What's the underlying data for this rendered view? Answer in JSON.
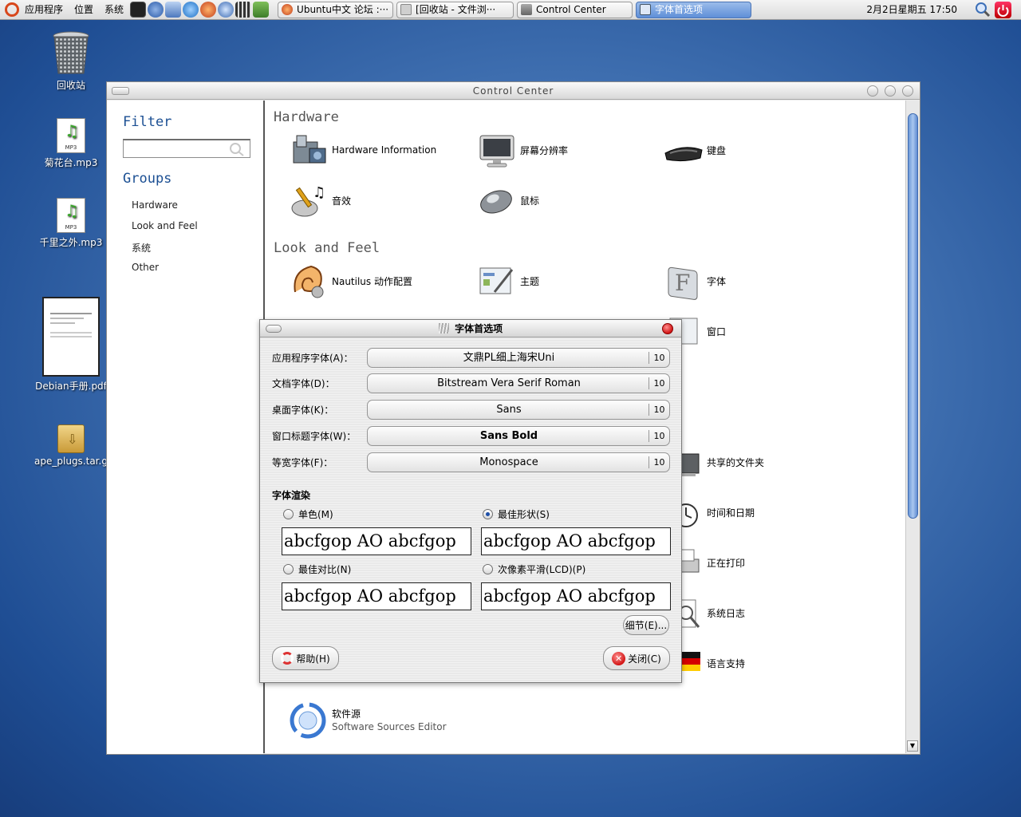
{
  "panel": {
    "menus": [
      "应用程序",
      "位置",
      "系统"
    ],
    "tasks": [
      {
        "label": "Ubuntu中文 论坛 :···"
      },
      {
        "label": "[回收站 - 文件浏···"
      },
      {
        "label": "Control Center"
      },
      {
        "label": "字体首选项"
      }
    ],
    "clock": "2月2日星期五 17:50"
  },
  "desktop": {
    "icons": [
      {
        "label": "回收站"
      },
      {
        "label": "菊花台.mp3",
        "badge": "MP3"
      },
      {
        "label": "千里之外.mp3",
        "badge": "MP3"
      },
      {
        "label": "Debian手册.pdf"
      },
      {
        "label": "ape_plugs.tar.g"
      }
    ]
  },
  "window": {
    "title": "Control Center",
    "filter": {
      "heading": "Filter",
      "value": ""
    },
    "groups": {
      "heading": "Groups",
      "items": [
        "Hardware",
        "Look and Feel",
        "系统",
        "Other"
      ]
    },
    "sections": {
      "hardware": {
        "title": "Hardware",
        "items": [
          "Hardware Information",
          "屏幕分辨率",
          "键盘",
          "音效",
          "鼠标"
        ]
      },
      "look": {
        "title": "Look and Feel",
        "items": [
          "Nautilus 动作配置",
          "主题",
          "字体",
          "窗口"
        ]
      },
      "system_right": [
        "共享的文件夹",
        "时间和日期",
        "正在打印",
        "系统日志",
        "语言支持"
      ],
      "software": {
        "title": "软件源",
        "subtitle": "Software Sources Editor"
      }
    }
  },
  "dialog": {
    "title": "字体首选项",
    "fonts": [
      {
        "label": "应用程序字体(A)：",
        "name": "文鼎PL细上海宋Uni",
        "size": "10"
      },
      {
        "label": "文档字体(D)：",
        "name": "Bitstream Vera Serif Roman",
        "size": "10"
      },
      {
        "label": "桌面字体(K)：",
        "name": "Sans",
        "size": "10"
      },
      {
        "label": "窗口标题字体(W)：",
        "name": "Sans Bold",
        "size": "10"
      },
      {
        "label": "等宽字体(F)：",
        "name": "Monospace",
        "size": "10"
      }
    ],
    "rendering": {
      "heading": "字体渲染",
      "options": [
        {
          "label": "单色(M)",
          "selected": false,
          "sample": "abcfgop AO abcfgop"
        },
        {
          "label": "最佳形状(S)",
          "selected": true,
          "sample": "abcfgop AO abcfgop"
        },
        {
          "label": "最佳对比(N)",
          "selected": false,
          "sample": "abcfgop AO abcfgop"
        },
        {
          "label": "次像素平滑(LCD)(P)",
          "selected": false,
          "sample": "abcfgop AO abcfgop"
        }
      ]
    },
    "details_button": "细节(E)...",
    "help_button": "帮助(H)",
    "close_button": "关闭(C)"
  }
}
